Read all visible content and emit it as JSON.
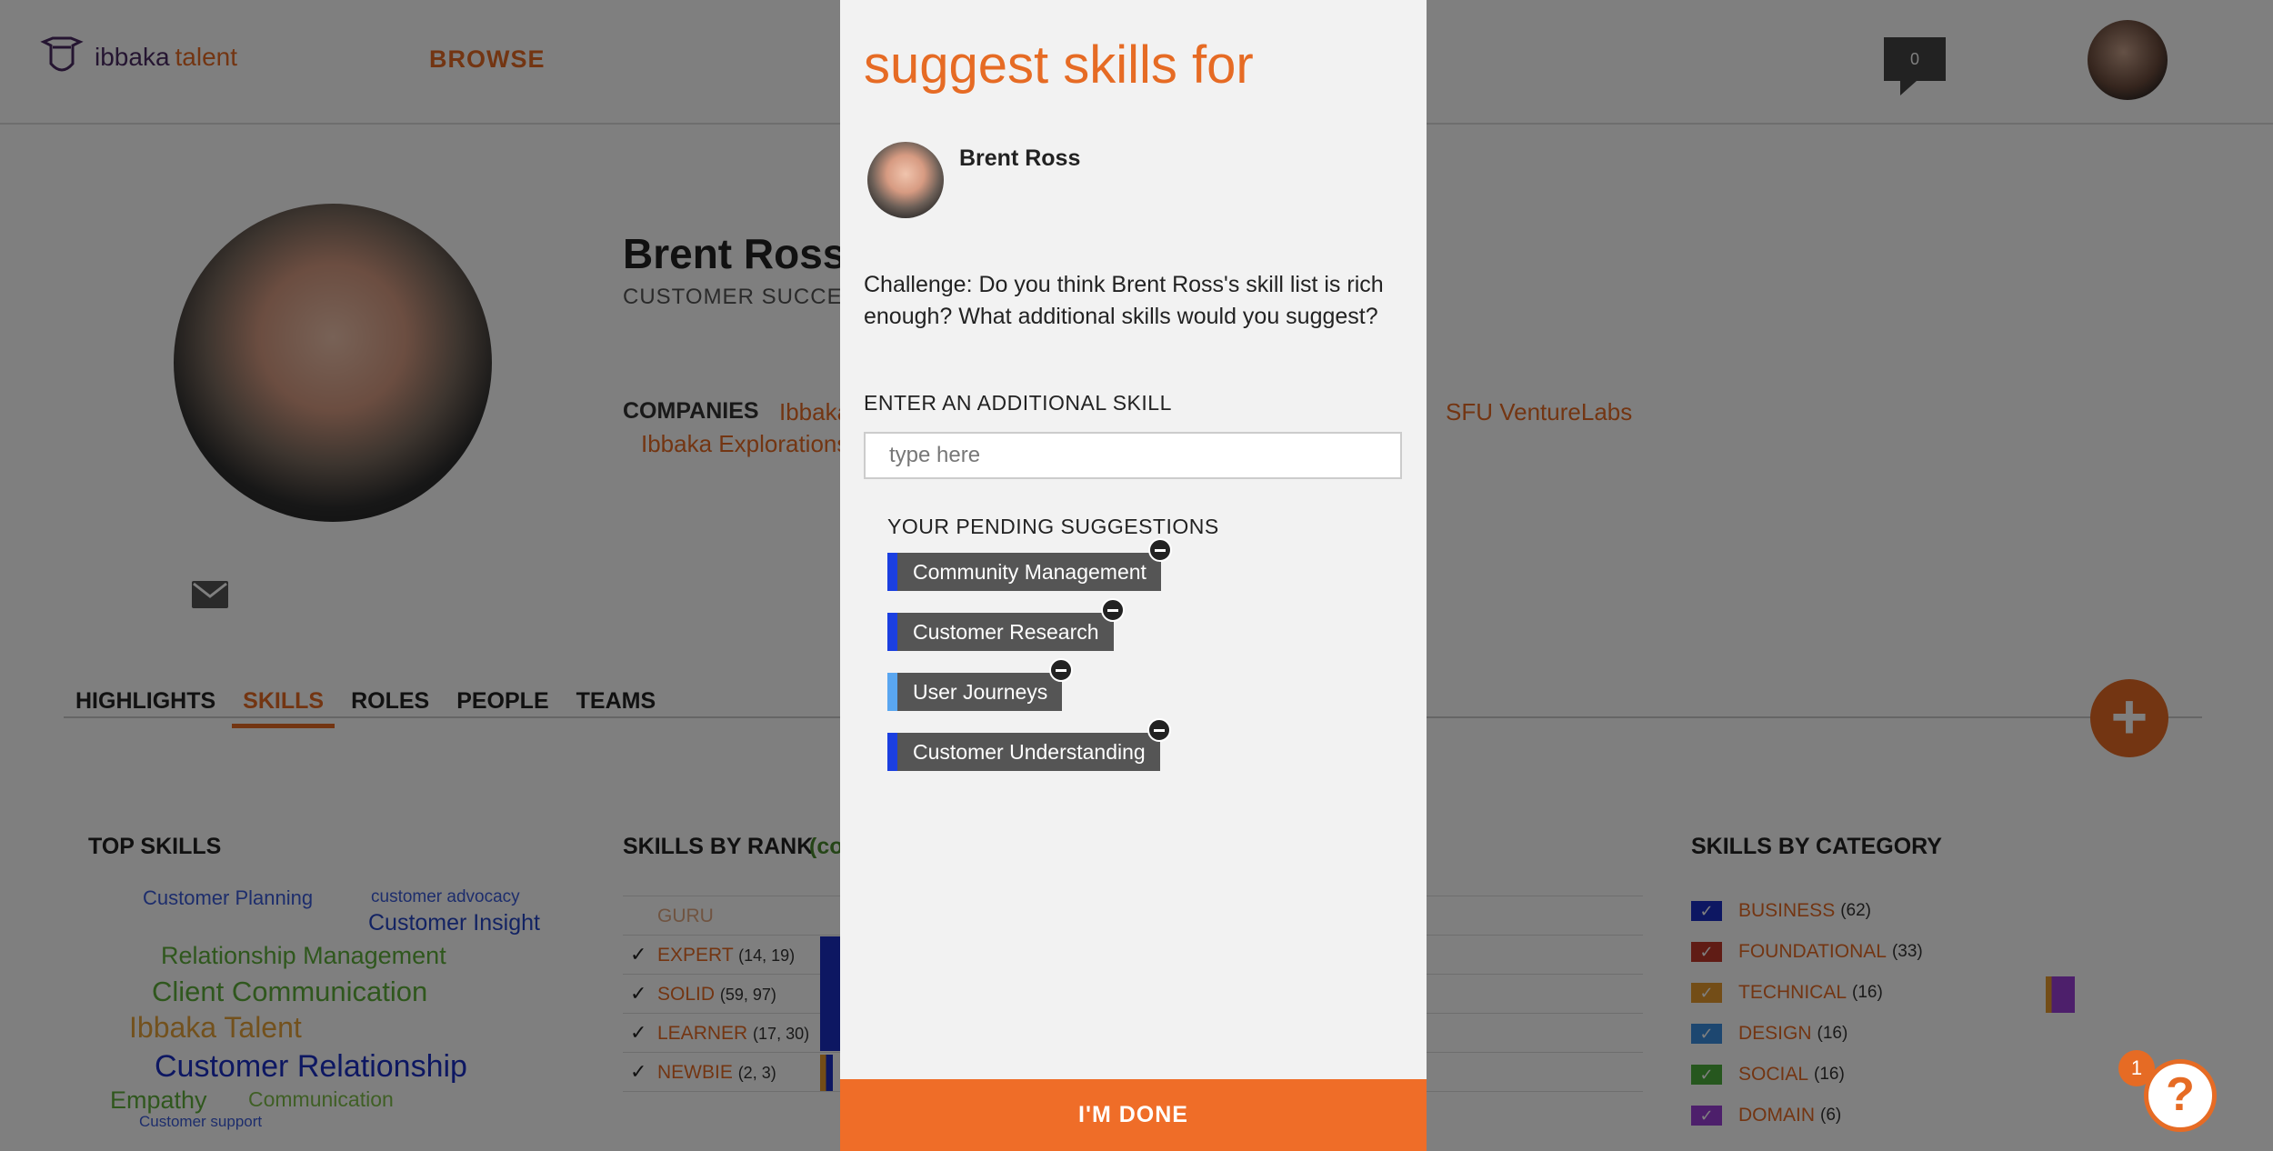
{
  "header": {
    "logo_part1": "ibbaka",
    "logo_part2": "talent",
    "browse": "BROWSE",
    "notifications": "0"
  },
  "profile": {
    "name": "Brent Ross",
    "role": "CUSTOMER SUCCESS",
    "companies_label": "COMPANIES",
    "companies": [
      "Ibbaka",
      "Ibbaka Explorations",
      "SFU VentureLabs"
    ]
  },
  "tabs": [
    "HIGHLIGHTS",
    "SKILLS",
    "ROLES",
    "PEOPLE",
    "TEAMS"
  ],
  "active_tab": "SKILLS",
  "top_skills": {
    "title": "TOP SKILLS",
    "words": [
      {
        "text": "Customer Planning",
        "color": "#3a5bd9"
      },
      {
        "text": "customer advocacy",
        "color": "#3a5bd9"
      },
      {
        "text": "Customer Insight",
        "color": "#2746c7"
      },
      {
        "text": "Relationship Management",
        "color": "#5fae3b"
      },
      {
        "text": "Client Communication",
        "color": "#5fae3b"
      },
      {
        "text": "Ibbaka Talent",
        "color": "#e6a33a"
      },
      {
        "text": "Customer Relationship",
        "color": "#1b2fc4"
      },
      {
        "text": "Empathy",
        "color": "#5fae3b"
      },
      {
        "text": "Communication",
        "color": "#7fbf4a"
      },
      {
        "text": "Customer support",
        "color": "#3a5bd9"
      }
    ]
  },
  "skills_by_rank": {
    "title": "SKILLS BY RANK",
    "subtitle": "(co",
    "rows": [
      {
        "label": "GURU",
        "count": "",
        "checked": false
      },
      {
        "label": "EXPERT",
        "count": "(14, 19)",
        "checked": true
      },
      {
        "label": "SOLID",
        "count": "(59, 97)",
        "checked": true
      },
      {
        "label": "LEARNER",
        "count": "(17, 30)",
        "checked": true
      },
      {
        "label": "NEWBIE",
        "count": "(2, 3)",
        "checked": true
      }
    ]
  },
  "skills_by_category": {
    "title": "SKILLS BY CATEGORY",
    "items": [
      {
        "name": "BUSINESS",
        "count": "(62)",
        "color": "#1b2fc4"
      },
      {
        "name": "FOUNDATIONAL",
        "count": "(33)",
        "color": "#c0392b"
      },
      {
        "name": "TECHNICAL",
        "count": "(16)",
        "color": "#e69a2e"
      },
      {
        "name": "DESIGN",
        "count": "(16)",
        "color": "#3a8fe0"
      },
      {
        "name": "SOCIAL",
        "count": "(16)",
        "color": "#4caf3c"
      },
      {
        "name": "DOMAIN",
        "count": "(6)",
        "color": "#9b3fd6"
      }
    ]
  },
  "help": {
    "badge": "1",
    "icon": "?"
  },
  "modal": {
    "title": "suggest skills for",
    "person_name": "Brent Ross",
    "challenge": "Challenge: Do you think Brent Ross's skill list is rich enough? What additional skills would you suggest?",
    "input_label": "ENTER AN ADDITIONAL SKILL",
    "input_placeholder": "type here",
    "input_value": "",
    "pending_label": "YOUR PENDING SUGGESTIONS",
    "suggestions": [
      {
        "label": "Community Management",
        "color": "#1b3fe0"
      },
      {
        "label": "Customer Research",
        "color": "#1b3fe0"
      },
      {
        "label": "User Journeys",
        "color": "#5aa6f0"
      },
      {
        "label": "Customer Understanding",
        "color": "#1b3fe0"
      }
    ],
    "done": "I'M DONE"
  },
  "colors": {
    "accent": "#e66b24"
  }
}
